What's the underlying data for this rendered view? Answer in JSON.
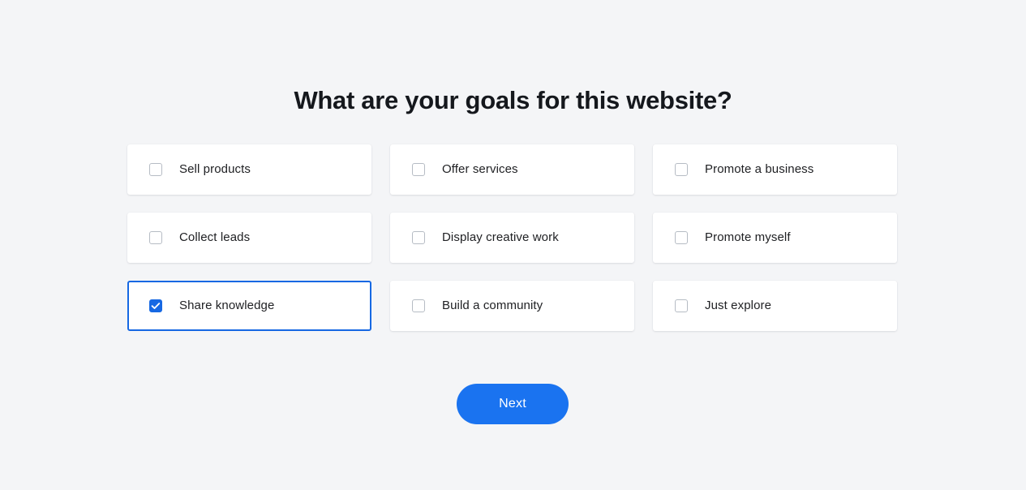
{
  "page": {
    "background_color": "#f4f5f7",
    "title": "What are your goals for this website?"
  },
  "goals": {
    "items": [
      {
        "label": "Sell products",
        "checked": false
      },
      {
        "label": "Offer services",
        "checked": false
      },
      {
        "label": "Promote a business",
        "checked": false
      },
      {
        "label": "Collect leads",
        "checked": false
      },
      {
        "label": "Display creative work",
        "checked": false
      },
      {
        "label": "Promote myself",
        "checked": false
      },
      {
        "label": "Share knowledge",
        "checked": true
      },
      {
        "label": "Build a community",
        "checked": false
      },
      {
        "label": "Just explore",
        "checked": false
      }
    ],
    "checkbox_icon": "checkbox-icon",
    "checked_icon": "checkmark-icon",
    "selected_border_color": "#1668e3",
    "checked_fill_color": "#1668e3",
    "card_background_color": "#ffffff",
    "label_color": "#202124"
  },
  "footer": {
    "next_label": "Next",
    "next_background_color": "#1a73f0",
    "next_text_color": "#ffffff"
  }
}
